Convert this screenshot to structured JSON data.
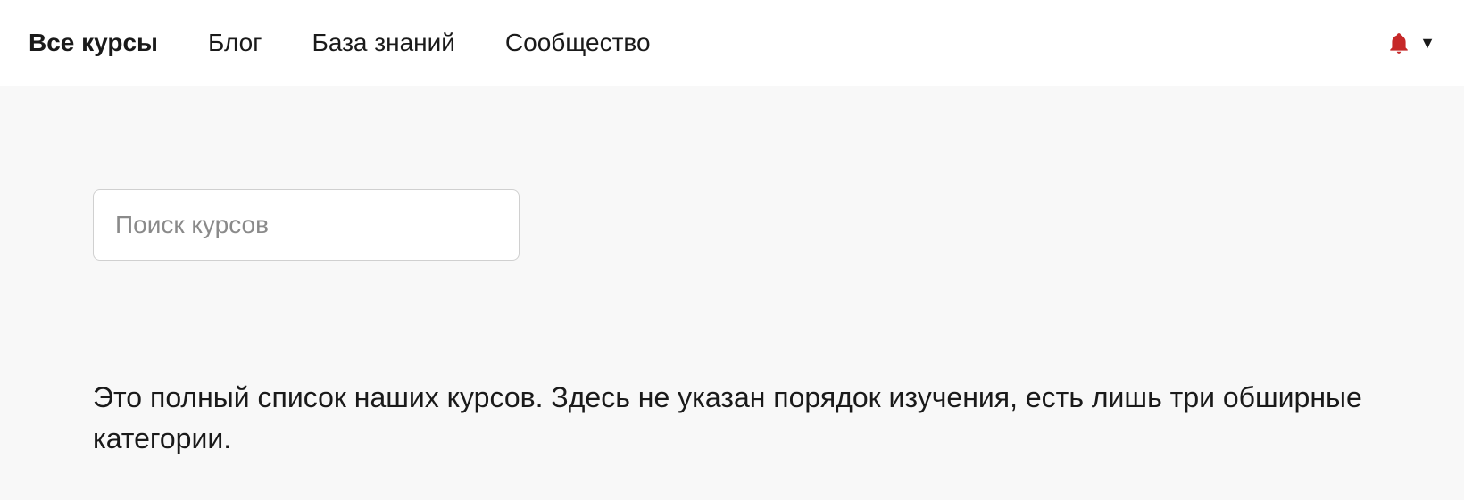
{
  "nav": {
    "items": [
      {
        "label": "Все курсы",
        "active": true
      },
      {
        "label": "Блог",
        "active": false
      },
      {
        "label": "База знаний",
        "active": false
      },
      {
        "label": "Сообщество",
        "active": false
      }
    ]
  },
  "search": {
    "placeholder": "Поиск курсов",
    "value": ""
  },
  "description": "Это полный список наших курсов. Здесь не указан порядок изучения, есть лишь три обширные категории.",
  "colors": {
    "accent": "#c62828"
  }
}
